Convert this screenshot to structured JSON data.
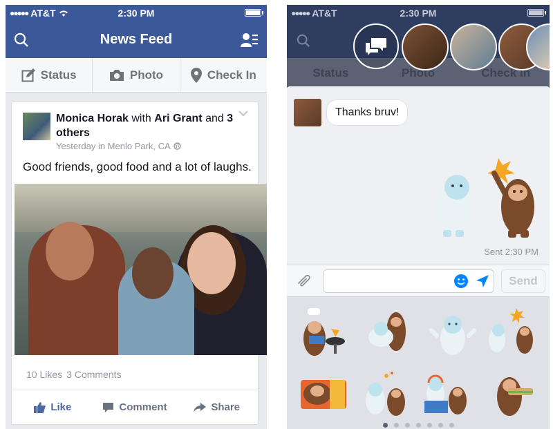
{
  "colors": {
    "brand": "#3b5998",
    "like_blue": "#4e69a2",
    "messenger_blue": "#0084ff"
  },
  "left": {
    "status": {
      "carrier": "AT&T",
      "time": "2:30 PM"
    },
    "header": {
      "title": "News Feed"
    },
    "actions": [
      {
        "label": "Status",
        "icon": "edit-icon"
      },
      {
        "label": "Photo",
        "icon": "camera-icon"
      },
      {
        "label": "Check In",
        "icon": "location-pin-icon"
      }
    ],
    "post": {
      "author": "Monica Horak",
      "with_word": "with",
      "tagged": "Ari Grant",
      "and_word": "and",
      "others": "3 others",
      "time": "Yesterday in Menlo Park, CA",
      "text": "Good friends, good food and a lot of laughs.",
      "likes": "10 Likes",
      "comments": "3 Comments",
      "footer": [
        {
          "label": "Like",
          "icon": "thumbs-up-icon"
        },
        {
          "label": "Comment",
          "icon": "comment-icon"
        },
        {
          "label": "Share",
          "icon": "share-icon"
        }
      ]
    }
  },
  "right": {
    "status": {
      "carrier": "AT&T",
      "time": "2:30 PM"
    },
    "ghost_actions": [
      "Status",
      "Photo",
      "Check In"
    ],
    "message": "Thanks bruv!",
    "sent": "Sent 2:30 PM",
    "send_label": "Send",
    "input_placeholder": ""
  }
}
